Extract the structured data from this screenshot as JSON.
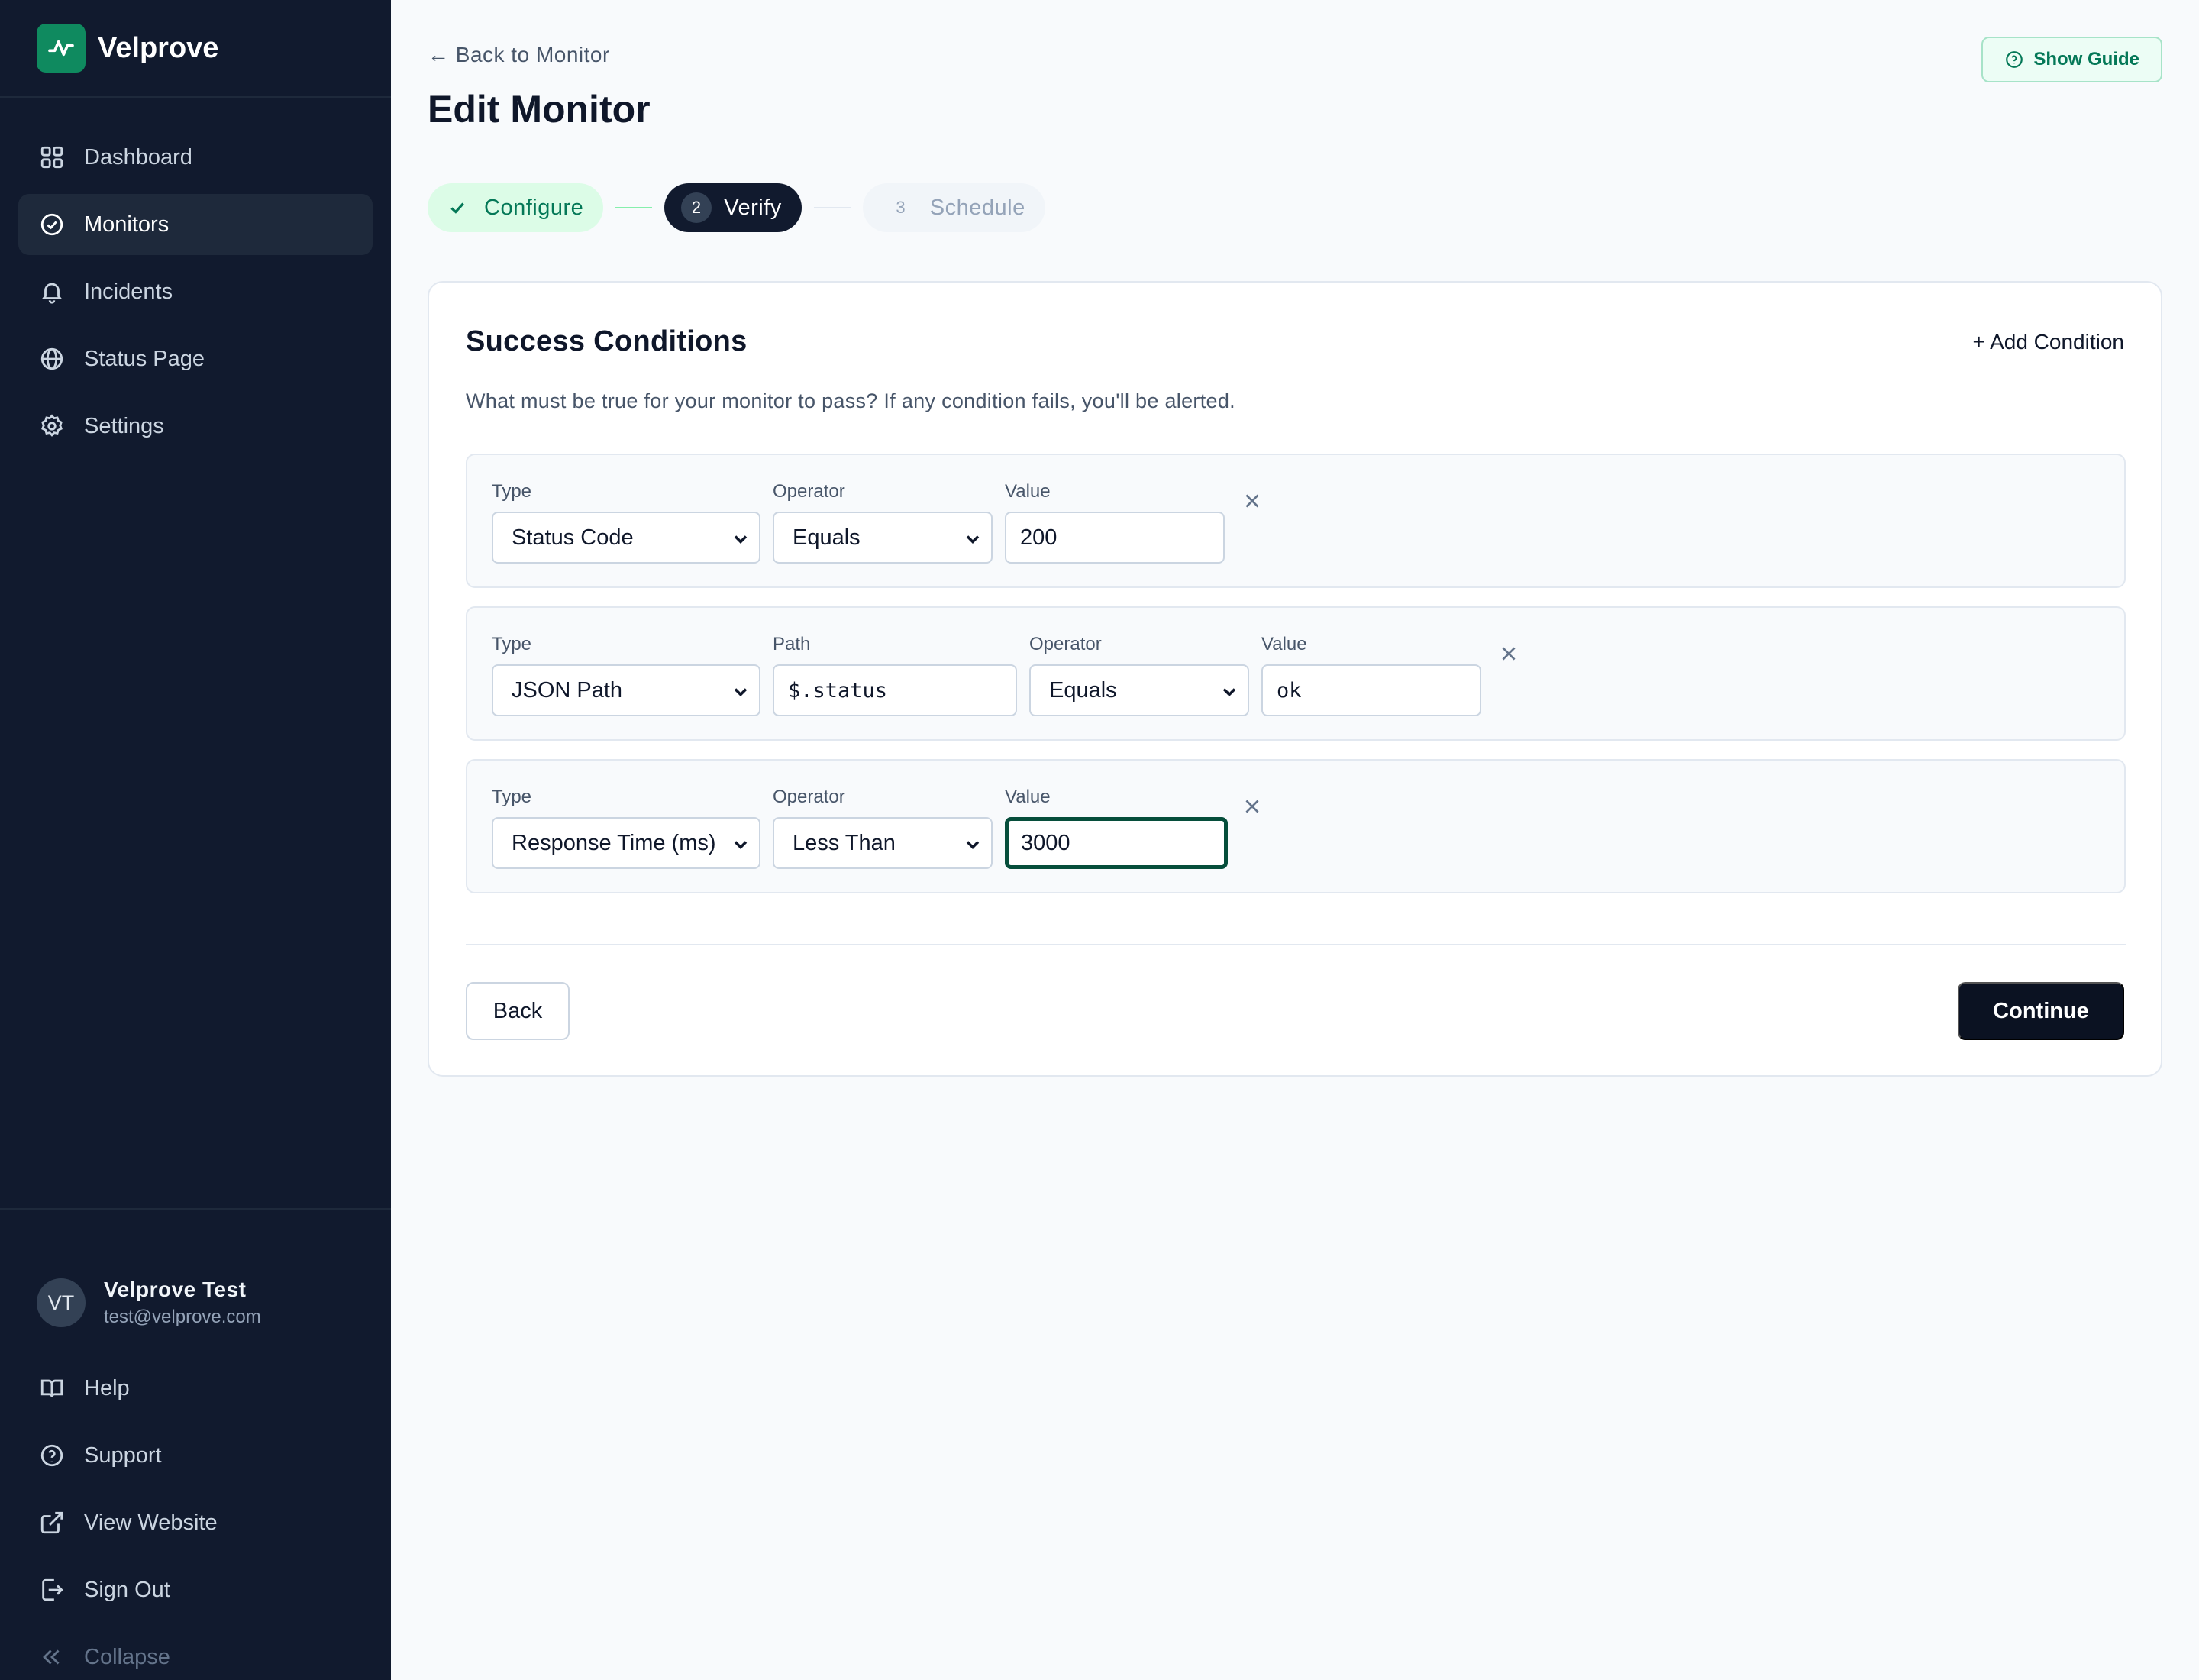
{
  "app": {
    "name": "Velprove"
  },
  "sidebar": {
    "items": [
      {
        "label": "Dashboard",
        "icon": "grid-icon"
      },
      {
        "label": "Monitors",
        "icon": "check-circle-icon",
        "active": true
      },
      {
        "label": "Incidents",
        "icon": "bell-icon"
      },
      {
        "label": "Status Page",
        "icon": "globe-icon"
      },
      {
        "label": "Settings",
        "icon": "gear-icon"
      }
    ],
    "user": {
      "initials": "VT",
      "name": "Velprove Test",
      "email": "test@velprove.com"
    },
    "bottom_items": [
      {
        "label": "Help",
        "icon": "book-icon"
      },
      {
        "label": "Support",
        "icon": "help-circle-icon"
      },
      {
        "label": "View Website",
        "icon": "external-link-icon"
      },
      {
        "label": "Sign Out",
        "icon": "sign-out-icon"
      },
      {
        "label": "Collapse",
        "icon": "chevrons-left-icon"
      }
    ]
  },
  "header": {
    "back_link": "← Back to Monitor",
    "title": "Edit Monitor",
    "guide_button": "Show Guide"
  },
  "stepper": {
    "steps": [
      {
        "label": "Configure",
        "state": "done"
      },
      {
        "number": "2",
        "label": "Verify",
        "state": "current"
      },
      {
        "number": "3",
        "label": "Schedule",
        "state": "future"
      }
    ]
  },
  "conditions_card": {
    "title": "Success Conditions",
    "add_label": "+ Add Condition",
    "description": "What must be true for your monitor to pass? If any condition fails, you'll be alerted.",
    "conditions": [
      {
        "type_label": "Type",
        "type": "Status Code",
        "operator_label": "Operator",
        "operator": "Equals",
        "value_label": "Value",
        "value": "200"
      },
      {
        "type_label": "Type",
        "type": "JSON Path",
        "path_label": "Path",
        "path": "$.status",
        "operator_label": "Operator",
        "operator": "Equals",
        "value_label": "Value",
        "value": "ok"
      },
      {
        "type_label": "Type",
        "type": "Response Time (ms)",
        "operator_label": "Operator",
        "operator": "Less Than",
        "value_label": "Value",
        "value": "3000"
      }
    ],
    "back_button": "Back",
    "continue_button": "Continue"
  },
  "colors": {
    "sidebar_bg": "#111a2e",
    "brand_green": "#0f8a5f",
    "accent_dark": "#0b1222",
    "focus_ring": "#064e3b"
  }
}
